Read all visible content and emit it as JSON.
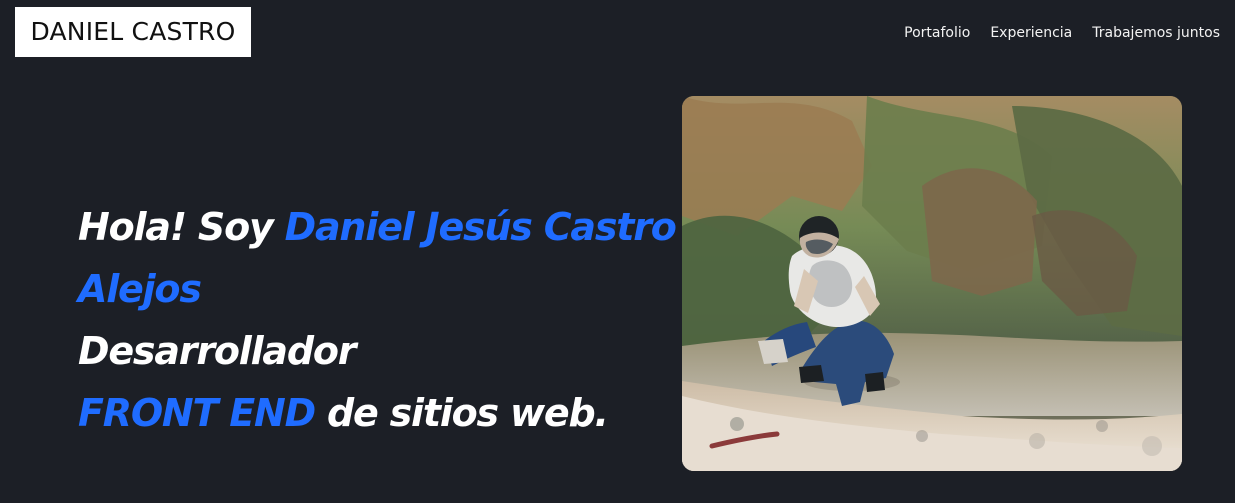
{
  "header": {
    "brand": "DANIEL CASTRO",
    "nav": [
      {
        "label": "Portafolio"
      },
      {
        "label": "Experiencia"
      },
      {
        "label": "Trabajemos juntos"
      }
    ]
  },
  "hero": {
    "greeting": "Hola! Soy ",
    "name": "Daniel Jesús Castro Alejos",
    "role": "Desarrollador",
    "highlight": "FRONT END",
    "rest": " de sitios web."
  },
  "photo": {
    "alt": "Foto de Daniel Jesús Castro Alejos"
  },
  "colors": {
    "background": "#1c1f26",
    "accent": "#1f6cff",
    "text": "#ffffff"
  }
}
